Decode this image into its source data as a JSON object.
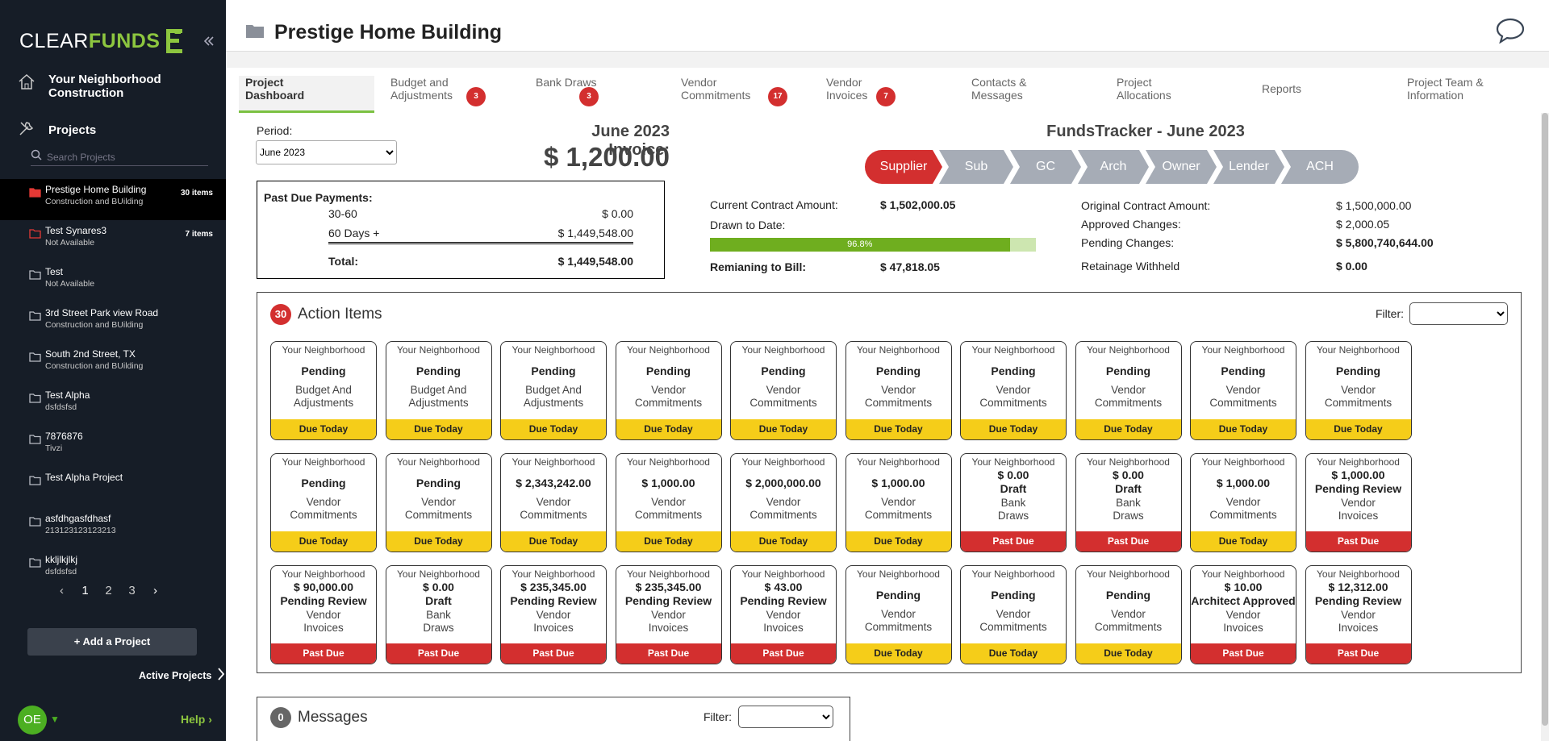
{
  "sidebar": {
    "logo": {
      "part1": "CLEAR",
      "part2": "FUNDS"
    },
    "company": "Your Neighborhood Construction",
    "projects_heading": "Projects",
    "search_placeholder": "Search Projects",
    "projects": [
      {
        "name": "Prestige Home Building",
        "sub": "Construction and BUilding",
        "count": "30 items",
        "active": true
      },
      {
        "name": "Test Synares3",
        "sub": "Not Available",
        "count": "7 items",
        "active": false
      },
      {
        "name": "Test",
        "sub": "Not Available",
        "count": "",
        "active": false
      },
      {
        "name": "3rd Street Park view Road",
        "sub": "Construction and BUilding",
        "count": "",
        "active": false
      },
      {
        "name": "South 2nd Street, TX",
        "sub": "Construction and BUilding",
        "count": "",
        "active": false
      },
      {
        "name": "Test Alpha",
        "sub": "dsfdsfsd",
        "count": "",
        "active": false
      },
      {
        "name": "7876876",
        "sub": "Tivzi",
        "count": "",
        "active": false
      },
      {
        "name": "Test Alpha Project",
        "sub": "",
        "count": "",
        "active": false
      },
      {
        "name": "asfdhgasfdhasf",
        "sub": "213123123123213",
        "count": "",
        "active": false
      },
      {
        "name": "kkljlkjlkj",
        "sub": "dsfdsfsd",
        "count": "",
        "active": false
      }
    ],
    "pager": {
      "pages": [
        "1",
        "2",
        "3"
      ],
      "current": "1"
    },
    "add_project": "+ Add a Project",
    "active_projects": "Active Projects",
    "avatar": "OE",
    "help": "Help"
  },
  "header": {
    "title": "Prestige Home Building"
  },
  "tabs": [
    {
      "label": "Project Dashboard",
      "badge": ""
    },
    {
      "label": "Budget and Adjustments",
      "badge": "3"
    },
    {
      "label": "Bank Draws",
      "badge": "3"
    },
    {
      "label": "Vendor Commitments",
      "badge": "17"
    },
    {
      "label": "Vendor Invoices",
      "badge": "7"
    },
    {
      "label": "Contacts & Messages",
      "badge": ""
    },
    {
      "label": "Project Allocations",
      "badge": ""
    },
    {
      "label": "Reports",
      "badge": ""
    },
    {
      "label": "Project Team & Information",
      "badge": ""
    }
  ],
  "period": {
    "label": "Period:",
    "selected": "June 2023"
  },
  "invoice": {
    "label": "June 2023 Invoice:",
    "amount": "$ 1,200.00"
  },
  "past_due": {
    "heading": "Past Due Payments:",
    "rows": [
      {
        "label": "30-60",
        "value": "$ 0.00"
      },
      {
        "label": "60 Days +",
        "value": "$ 1,449,548.00"
      }
    ],
    "total_label": "Total:",
    "total_value": "$ 1,449,548.00"
  },
  "funds_tracker": {
    "title": "FundsTracker - June 2023",
    "steps": [
      "Supplier",
      "Sub",
      "GC",
      "Arch",
      "Owner",
      "Lender",
      "ACH"
    ],
    "active_color": "#d32f2f",
    "inactive_color": "#a6acb6"
  },
  "contract": {
    "current_label": "Current Contract Amount:",
    "current_value": "$ 1,502,000.05",
    "drawn_label": "Drawn to Date:",
    "drawn_percent_text": "96.8%",
    "drawn_fraction": 0.968,
    "remaining_label": "Remaining to Bill:",
    "remaining_label_display": "Remianing to Bill:",
    "remaining_value": "$ 47,818.05",
    "original_label": "Original Contract Amount:",
    "original_value": "$ 1,500,000.00",
    "approved_label": "Approved Changes:",
    "approved_value": "$ 2,000.05",
    "pending_label": "Pending Changes:",
    "pending_value": "$ 5,800,740,644.00",
    "retainage_label": "Retainage Withheld",
    "retainage_value": "$ 0.00"
  },
  "action_items": {
    "count": "30",
    "title": "Action Items",
    "filter_label": "Filter:",
    "items": [
      {
        "company": "Your Neighborhood",
        "amount": "",
        "status": "Pending",
        "type1": "Budget And",
        "type2": "Adjustments",
        "due": "Due Today"
      },
      {
        "company": "Your Neighborhood",
        "amount": "",
        "status": "Pending",
        "type1": "Budget And",
        "type2": "Adjustments",
        "due": "Due Today"
      },
      {
        "company": "Your Neighborhood",
        "amount": "",
        "status": "Pending",
        "type1": "Budget And",
        "type2": "Adjustments",
        "due": "Due Today"
      },
      {
        "company": "Your Neighborhood",
        "amount": "",
        "status": "Pending",
        "type1": "Vendor",
        "type2": "Commitments",
        "due": "Due Today"
      },
      {
        "company": "Your Neighborhood",
        "amount": "",
        "status": "Pending",
        "type1": "Vendor",
        "type2": "Commitments",
        "due": "Due Today"
      },
      {
        "company": "Your Neighborhood",
        "amount": "",
        "status": "Pending",
        "type1": "Vendor",
        "type2": "Commitments",
        "due": "Due Today"
      },
      {
        "company": "Your Neighborhood",
        "amount": "",
        "status": "Pending",
        "type1": "Vendor",
        "type2": "Commitments",
        "due": "Due Today"
      },
      {
        "company": "Your Neighborhood",
        "amount": "",
        "status": "Pending",
        "type1": "Vendor",
        "type2": "Commitments",
        "due": "Due Today"
      },
      {
        "company": "Your Neighborhood",
        "amount": "",
        "status": "Pending",
        "type1": "Vendor",
        "type2": "Commitments",
        "due": "Due Today"
      },
      {
        "company": "Your Neighborhood",
        "amount": "",
        "status": "Pending",
        "type1": "Vendor",
        "type2": "Commitments",
        "due": "Due Today"
      },
      {
        "company": "Your Neighborhood",
        "amount": "",
        "status": "Pending",
        "type1": "Vendor",
        "type2": "Commitments",
        "due": "Due Today"
      },
      {
        "company": "Your Neighborhood",
        "amount": "",
        "status": "Pending",
        "type1": "Vendor",
        "type2": "Commitments",
        "due": "Due Today"
      },
      {
        "company": "Your Neighborhood",
        "amount": "",
        "status": "$ 2,343,242.00",
        "type1": "Vendor",
        "type2": "Commitments",
        "due": "Due Today"
      },
      {
        "company": "Your Neighborhood",
        "amount": "",
        "status": "$ 1,000.00",
        "type1": "Vendor",
        "type2": "Commitments",
        "due": "Due Today"
      },
      {
        "company": "Your Neighborhood",
        "amount": "",
        "status": "$ 2,000,000.00",
        "type1": "Vendor",
        "type2": "Commitments",
        "due": "Due Today"
      },
      {
        "company": "Your Neighborhood",
        "amount": "",
        "status": "$ 1,000.00",
        "type1": "Vendor",
        "type2": "Commitments",
        "due": "Due Today"
      },
      {
        "company": "Your Neighborhood",
        "amount": "$ 0.00",
        "status": "Draft",
        "type1": "Bank",
        "type2": "Draws",
        "due": "Past Due"
      },
      {
        "company": "Your Neighborhood",
        "amount": "$ 0.00",
        "status": "Draft",
        "type1": "Bank",
        "type2": "Draws",
        "due": "Past Due"
      },
      {
        "company": "Your Neighborhood",
        "amount": "",
        "status": "$ 1,000.00",
        "type1": "Vendor",
        "type2": "Commitments",
        "due": "Due Today"
      },
      {
        "company": "Your Neighborhood",
        "amount": "$ 1,000.00",
        "status": "Pending Review",
        "type1": "Vendor",
        "type2": "Invoices",
        "due": "Past Due"
      },
      {
        "company": "Your Neighborhood",
        "amount": "$ 90,000.00",
        "status": "Pending Review",
        "type1": "Vendor",
        "type2": "Invoices",
        "due": "Past Due"
      },
      {
        "company": "Your Neighborhood",
        "amount": "$ 0.00",
        "status": "Draft",
        "type1": "Bank",
        "type2": "Draws",
        "due": "Past Due"
      },
      {
        "company": "Your Neighborhood",
        "amount": "$ 235,345.00",
        "status": "Pending Review",
        "type1": "Vendor",
        "type2": "Invoices",
        "due": "Past Due"
      },
      {
        "company": "Your Neighborhood",
        "amount": "$ 235,345.00",
        "status": "Pending Review",
        "type1": "Vendor",
        "type2": "Invoices",
        "due": "Past Due"
      },
      {
        "company": "Your Neighborhood",
        "amount": "$ 43.00",
        "status": "Pending Review",
        "type1": "Vendor",
        "type2": "Invoices",
        "due": "Past Due"
      },
      {
        "company": "Your Neighborhood",
        "amount": "",
        "status": "Pending",
        "type1": "Vendor",
        "type2": "Commitments",
        "due": "Due Today"
      },
      {
        "company": "Your Neighborhood",
        "amount": "",
        "status": "Pending",
        "type1": "Vendor",
        "type2": "Commitments",
        "due": "Due Today"
      },
      {
        "company": "Your Neighborhood",
        "amount": "",
        "status": "Pending",
        "type1": "Vendor",
        "type2": "Commitments",
        "due": "Due Today"
      },
      {
        "company": "Your Neighborhood",
        "amount": "$ 10.00",
        "status": "Architect Approved",
        "type1": "Vendor",
        "type2": "Invoices",
        "due": "Past Due"
      },
      {
        "company": "Your Neighborhood",
        "amount": "$ 12,312.00",
        "status": "Pending Review",
        "type1": "Vendor",
        "type2": "Invoices",
        "due": "Past Due"
      }
    ]
  },
  "messages": {
    "count": "0",
    "title": "Messages",
    "filter_label": "Filter:"
  }
}
